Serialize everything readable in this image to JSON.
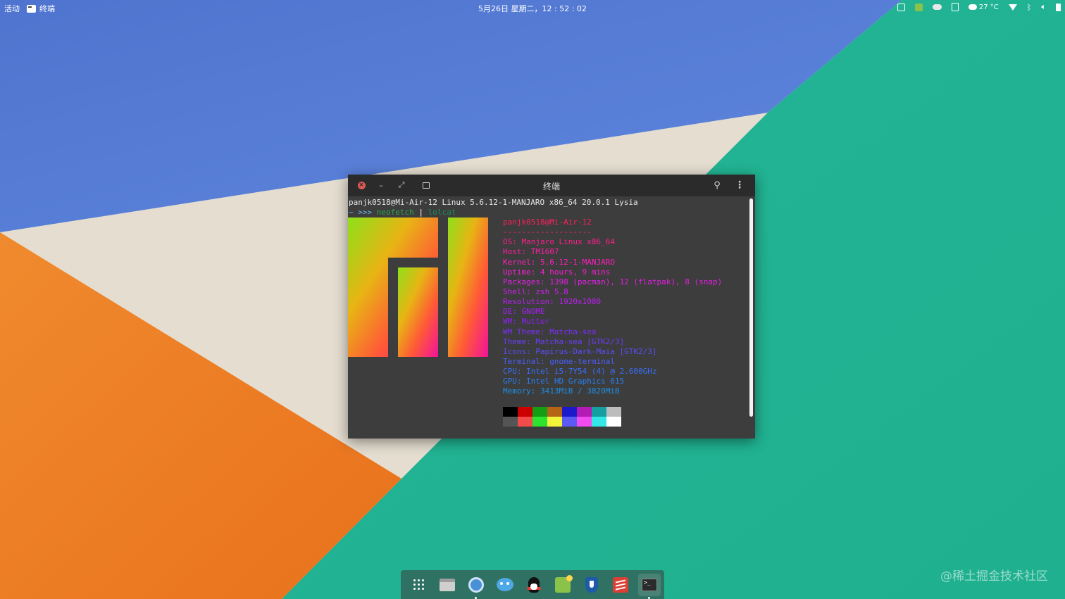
{
  "topbar": {
    "activities": "活动",
    "app_name": "终端",
    "clock": "5月26日 星期二，12 : 52 : 02",
    "temperature": "27 °C"
  },
  "window": {
    "title": "终端"
  },
  "terminal": {
    "line1": "panjk0518@Mi-Air-12 Linux 5.6.12-1-MANJARO x86_64 20.0.1 Lysia",
    "prompt": "~ >>>",
    "command": "neofetch",
    "pipe": "|",
    "pipe_cmd": "lolcat",
    "info": [
      {
        "text": "panjk0518@Mi-Air-12",
        "color": "#ff1e5c"
      },
      {
        "text": "-------------------",
        "color": "#ff1e74"
      },
      {
        "text": "OS: Manjaro Linux x86_64",
        "color": "#ff1e8c"
      },
      {
        "text": "Host: TM1607",
        "color": "#ff1ea4"
      },
      {
        "text": "Kernel: 5.6.12-1-MANJARO",
        "color": "#ff1ebc"
      },
      {
        "text": "Uptime: 4 hours, 9 mins",
        "color": "#f51ed2"
      },
      {
        "text": "Packages: 1398 (pacman), 12 (flatpak), 8 (snap)",
        "color": "#e51ee6"
      },
      {
        "text": "Shell: zsh 5.8",
        "color": "#d31ef4"
      },
      {
        "text": "Resolution: 1920x1080",
        "color": "#bd1ef8"
      },
      {
        "text": "DE: GNOME",
        "color": "#a51ef8"
      },
      {
        "text": "WM: Mutter",
        "color": "#8f1ef8"
      },
      {
        "text": "WM Theme: Matcha-sea",
        "color": "#7a2ef8"
      },
      {
        "text": "Theme: Matcha-sea [GTK2/3]",
        "color": "#6a3ef8"
      },
      {
        "text": "Icons: Papirus-Dark-Maia [GTK2/3]",
        "color": "#5a4ef8"
      },
      {
        "text": "Terminal: gnome-terminal",
        "color": "#4a5ef8"
      },
      {
        "text": "CPU: Intel i5-7Y54 (4) @ 2.600GHz",
        "color": "#3a6ef8"
      },
      {
        "text": "GPU: Intel HD Graphics 615",
        "color": "#2a7ef0"
      },
      {
        "text": "Memory: 3413MiB / 3820MiB",
        "color": "#1e8ee4"
      }
    ],
    "palette_top": [
      "#000000",
      "#cc0000",
      "#149e14",
      "#b46414",
      "#1a1acc",
      "#b41ab4",
      "#14a0a0",
      "#bcbcbc"
    ],
    "palette_bottom": [
      "#555555",
      "#f14b4b",
      "#2fe42f",
      "#f3f33c",
      "#5b5bf3",
      "#f04cf0",
      "#34e8e8",
      "#ffffff"
    ]
  },
  "dock": {
    "items": [
      "app-grid",
      "files",
      "browser",
      "chat",
      "qq",
      "rss-reader",
      "password-manager",
      "todoist",
      "terminal"
    ]
  },
  "watermark": "@稀土掘金技术社区"
}
